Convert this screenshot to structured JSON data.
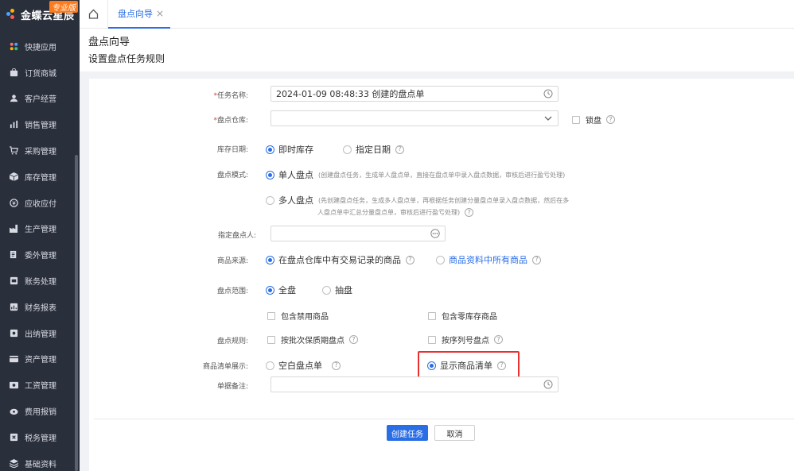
{
  "app": {
    "brand": "金蝶云星辰",
    "edition": "专业版"
  },
  "sidebar": {
    "items": [
      {
        "label": "快捷应用",
        "icon": "apps-icon"
      },
      {
        "label": "订货商城",
        "icon": "shopping-bag-icon"
      },
      {
        "label": "客户经营",
        "icon": "customer-icon"
      },
      {
        "label": "销售管理",
        "icon": "sales-icon"
      },
      {
        "label": "采购管理",
        "icon": "cart-icon"
      },
      {
        "label": "库存管理",
        "icon": "box-icon"
      },
      {
        "label": "应收应付",
        "icon": "money-icon"
      },
      {
        "label": "生产管理",
        "icon": "factory-icon"
      },
      {
        "label": "委外管理",
        "icon": "outsource-icon"
      },
      {
        "label": "账务处理",
        "icon": "ledger-icon"
      },
      {
        "label": "财务报表",
        "icon": "report-icon"
      },
      {
        "label": "出纳管理",
        "icon": "cashier-icon"
      },
      {
        "label": "资产管理",
        "icon": "asset-icon"
      },
      {
        "label": "工资管理",
        "icon": "salary-icon"
      },
      {
        "label": "费用报销",
        "icon": "expense-icon"
      },
      {
        "label": "税务管理",
        "icon": "tax-icon"
      },
      {
        "label": "基础资料",
        "icon": "layers-icon"
      }
    ]
  },
  "tabs": {
    "active_label": "盘点向导",
    "close_glyph": "×"
  },
  "page": {
    "title": "盘点向导",
    "subtitle": "设置盘点任务规则"
  },
  "form": {
    "task_name": {
      "label": "任务名称:",
      "value": "2024-01-09 08:48:33   创建的盘点单"
    },
    "warehouse": {
      "label": "盘点仓库:",
      "value": "",
      "lock_label": "锁盘"
    },
    "stock_date": {
      "label": "库存日期:",
      "options": [
        "即时库存",
        "指定日期"
      ],
      "selected": 0
    },
    "mode": {
      "label": "盘点模式:",
      "single": {
        "label": "单人盘点",
        "desc": "(创建盘点任务，生成单人盘点单，直接在盘点单中录入盘点数据，审核后进行盈亏处理)"
      },
      "multi": {
        "label": "多人盘点",
        "desc_line1": "(先创建盘点任务，生成多人盘点单，再根据任务创建分量盘点单录入盘点数据，然后在多",
        "desc_line2": "人盘点单中汇总分量盘点单，审核后进行盈亏处理)"
      }
    },
    "counter": {
      "label": "指定盘点人:",
      "value": ""
    },
    "source": {
      "label": "商品来源:",
      "options": [
        "在盘点仓库中有交易记录的商品",
        "商品资料中所有商品"
      ],
      "selected": 0
    },
    "scope": {
      "label": "盘点范围:",
      "options": [
        "全盘",
        "抽盘"
      ],
      "selected": 0
    },
    "include": {
      "disabled_goods": "包含禁用商品",
      "zero_stock": "包含零库存商品"
    },
    "rules": {
      "label": "盘点规则:",
      "batch": "按批次保质期盘点",
      "serial": "按序列号盘点"
    },
    "display": {
      "label": "商品清单展示:",
      "options": [
        "空白盘点单",
        "显示商品清单"
      ],
      "selected": 1
    },
    "remark": {
      "label": "单据备注:",
      "value": ""
    }
  },
  "buttons": {
    "create": "创建任务",
    "cancel": "取消"
  },
  "colors": {
    "accent": "#2a6ee5",
    "sidebar_bg": "#2a2f3c",
    "highlight": "#e8312f"
  }
}
